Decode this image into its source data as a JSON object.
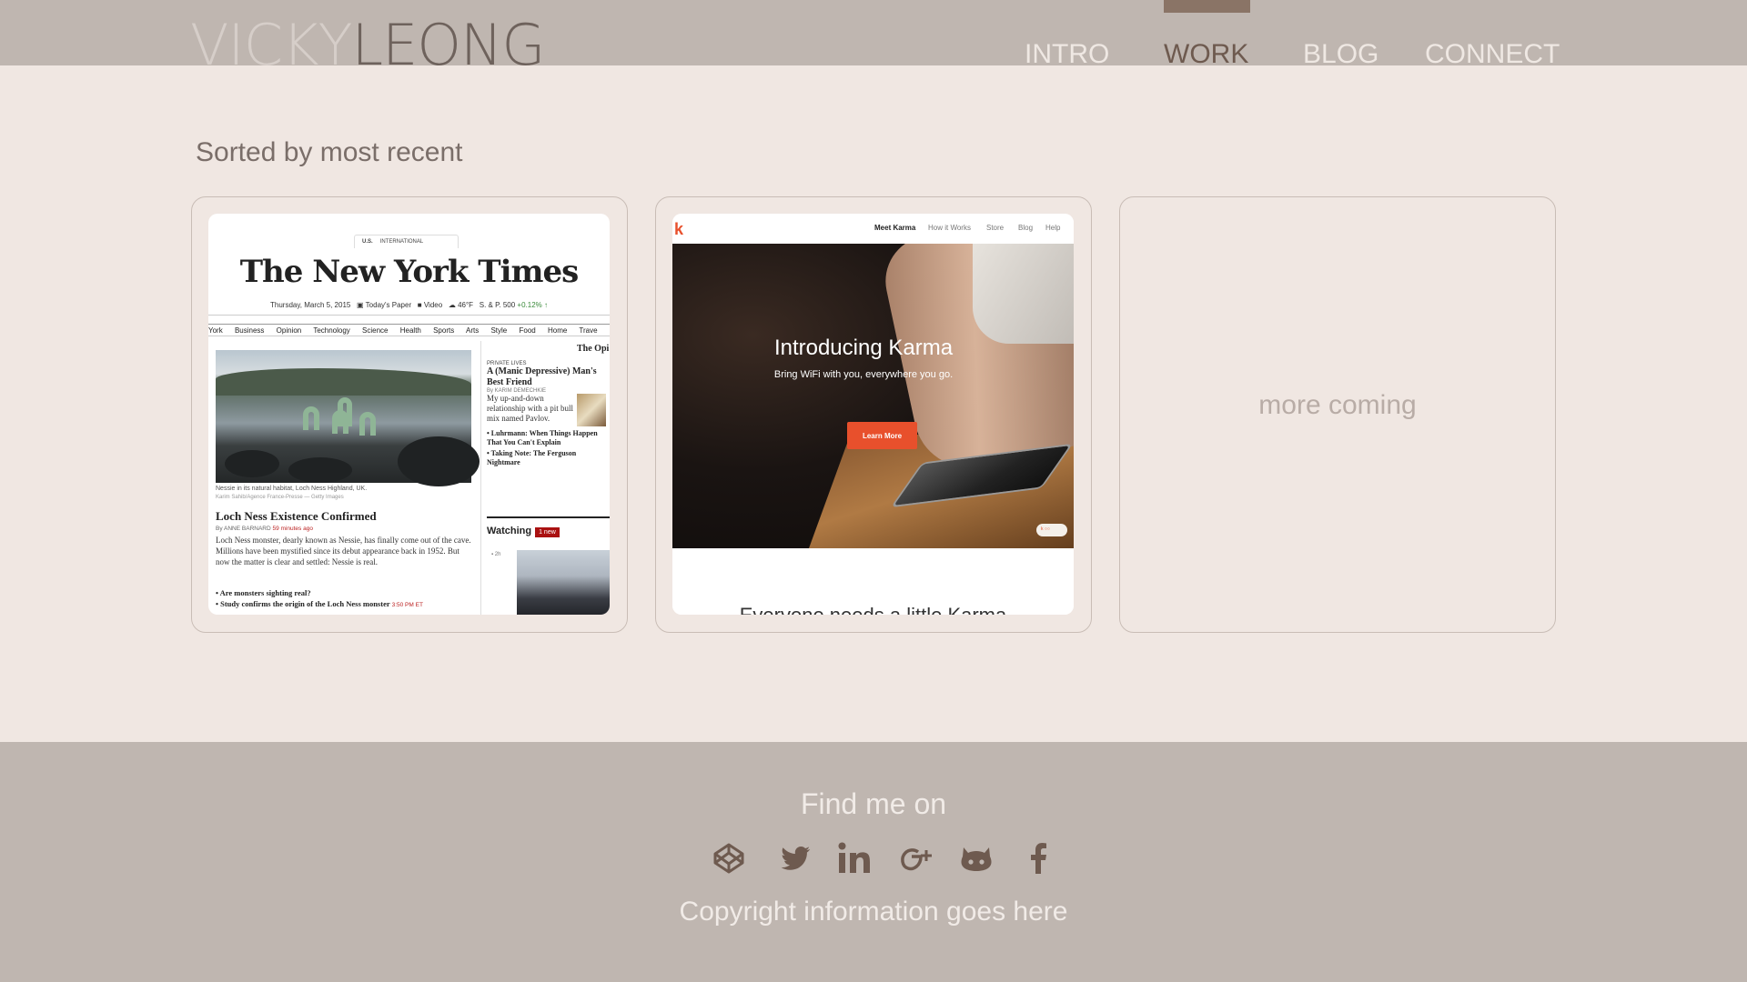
{
  "header": {
    "logo_first": "VICKY",
    "logo_last": "LEONG",
    "nav": {
      "intro": "INTRO",
      "work": "WORK",
      "blog": "BLOG",
      "connect": "CONNECT"
    },
    "active_nav": "WORK"
  },
  "main": {
    "section_title": "Sorted by most recent",
    "more_coming": "more coming",
    "nyt_card": {
      "edition_us": "U.S.",
      "edition_intl": "INTERNATIONAL",
      "masthead": "The New York Times",
      "date": "Thursday, March 5, 2015",
      "todays_paper": "Today's Paper",
      "video": "Video",
      "weather": "46°F",
      "index": "S. & P. 500",
      "index_change": "+0.12% ↑",
      "sections": [
        "York",
        "Business",
        "Opinion",
        "Technology",
        "Science",
        "Health",
        "Sports",
        "Arts",
        "Style",
        "Food",
        "Home",
        "Trave"
      ],
      "caption": "Nessie in its natural habitat, Loch Ness Highland, UK.",
      "credit": "Karim Sahib/Agence France-Presse — Getty Images",
      "headline": "Loch Ness Existence Confirmed",
      "byline": "By ANNE BARNARD",
      "byline_time": "59 minutes ago",
      "body": "Loch Ness monster, dearly known as Nessie, has finally come out of the cave. Millions have been mystified since its debut appearance back in 1952. But now the matter is clear and settled: Nessie is real.",
      "bullet1": "• Are monsters sighting real?",
      "bullet2": "• Study confirms the origin of the Loch Ness monster",
      "bullet2_time": "3:50 PM ET",
      "opinion_label": "The Opi",
      "kicker": "PRIVATE LIVES",
      "right_headline": "A (Manic Depressive) Man's Best Friend",
      "right_byline": "By KARIM DEMECHKIE",
      "right_text": "My up-and-down relationship with a pit bull mix named Pavlov.",
      "right_bullet1": "• Luhrmann: When Things Happen That You Can't Explain",
      "right_bullet2": "• Taking Note: The Ferguson Nightmare",
      "watching": "Watching",
      "watching_badge": "1 new",
      "watching_time": "2h"
    },
    "karma_card": {
      "logo": "k",
      "nav": [
        "Meet Karma",
        "How it Works",
        "Store",
        "Blog",
        "Help"
      ],
      "hero_title": "Introducing Karma",
      "hero_sub": "Bring WiFi with you, everywhere you go.",
      "cta": "Learn More",
      "tagline": "Everyone needs a little Karma"
    }
  },
  "footer": {
    "find_me": "Find me on",
    "social": [
      "codepen-icon",
      "twitter-icon",
      "linkedin-icon",
      "google-plus-icon",
      "github-icon",
      "facebook-icon"
    ],
    "copyright": "Copyright information goes here"
  },
  "colors": {
    "header_bg": "#bfb6b0",
    "page_bg": "#f0e7e2",
    "accent_brown": "#6e5a4f",
    "karma_orange": "#e8502c"
  }
}
